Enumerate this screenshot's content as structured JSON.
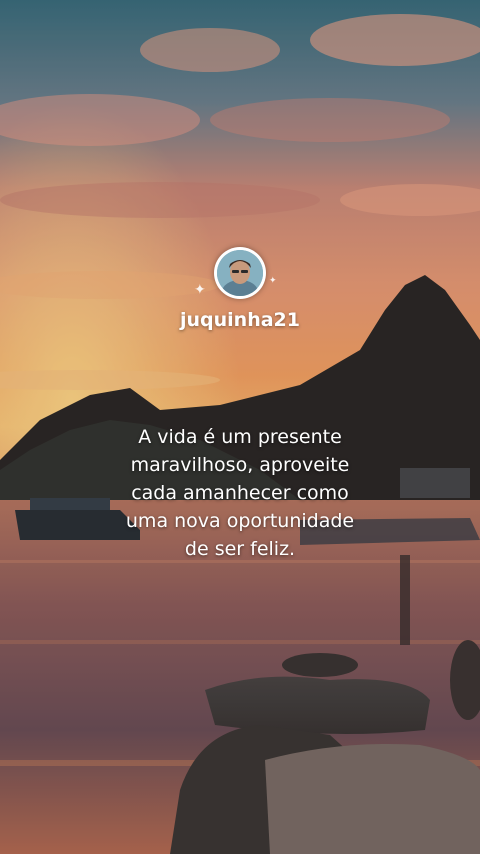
{
  "profile": {
    "username": "juquinha21"
  },
  "post": {
    "quote": "A vida é um presente\nmaravilhoso, aproveite\ncada amanhecer como\numa nova oportunidade\nde ser feliz."
  },
  "icons": {
    "avatar": "avatar-photo",
    "sparkle_left": "sparkle-icon",
    "sparkle_right": "sparkle-icon"
  },
  "colors": {
    "sky_top": "#3b6f7e",
    "sky_glow": "#f3a36a",
    "mountain": "#2a2826",
    "sea": "#8a5a56",
    "text": "#ffffff"
  }
}
